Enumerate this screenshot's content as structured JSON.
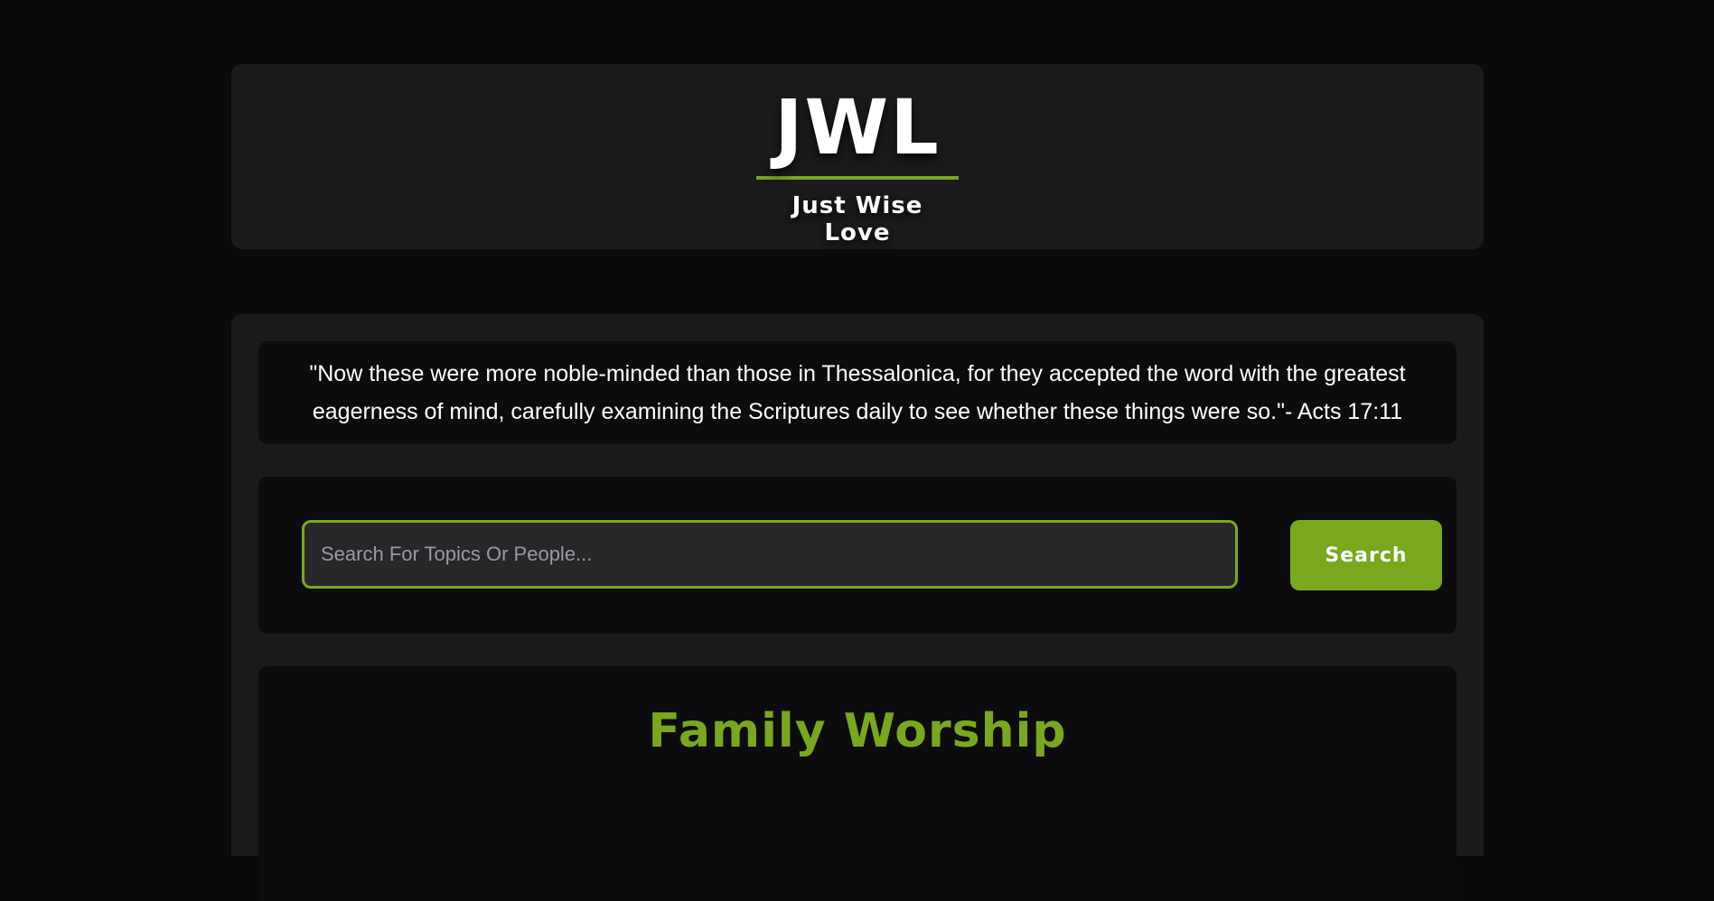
{
  "header": {
    "logo_text": "JWL",
    "tagline": "Just Wise Love"
  },
  "quote": {
    "text": "\"Now these were more noble-minded than those in Thessalonica, for they accepted the word with the greatest eagerness of mind, carefully examining the Scriptures daily to see whether these things were so.\"- Acts 17:11"
  },
  "search": {
    "placeholder": "Search For Topics Or People...",
    "value": "",
    "button_label": "Search"
  },
  "section": {
    "title": "Family Worship"
  },
  "colors": {
    "accent": "#79a81e",
    "background": "#0a0a0c",
    "card": "#1a1a1c",
    "inner_card": "#0c0c0e",
    "input_bg": "#27272a"
  }
}
